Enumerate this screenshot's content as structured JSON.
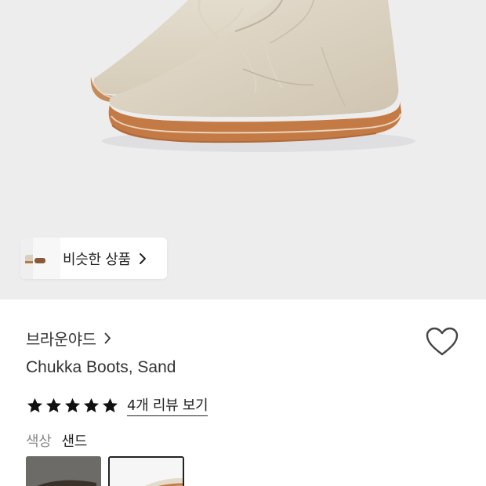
{
  "hero": {
    "image": "sand-suede-chukka-boots-photo",
    "background": "#ededee"
  },
  "similar_products": {
    "label": "비슷한 상품",
    "icon": "chevron-right-icon"
  },
  "product": {
    "brand": "브라운야드",
    "brand_icon": "chevron-right-icon",
    "title": "Chukka Boots, Sand",
    "rating_stars": 5,
    "review_link": "4개 리뷰 보기",
    "color_label": "색상",
    "color_value": "샌드",
    "wishlist_icon": "heart-outline-icon"
  },
  "swatches": [
    {
      "name": "dark",
      "color": "#6e6c69",
      "selected": false
    },
    {
      "name": "sand",
      "color": "#e8e0d2",
      "selected": true
    }
  ]
}
